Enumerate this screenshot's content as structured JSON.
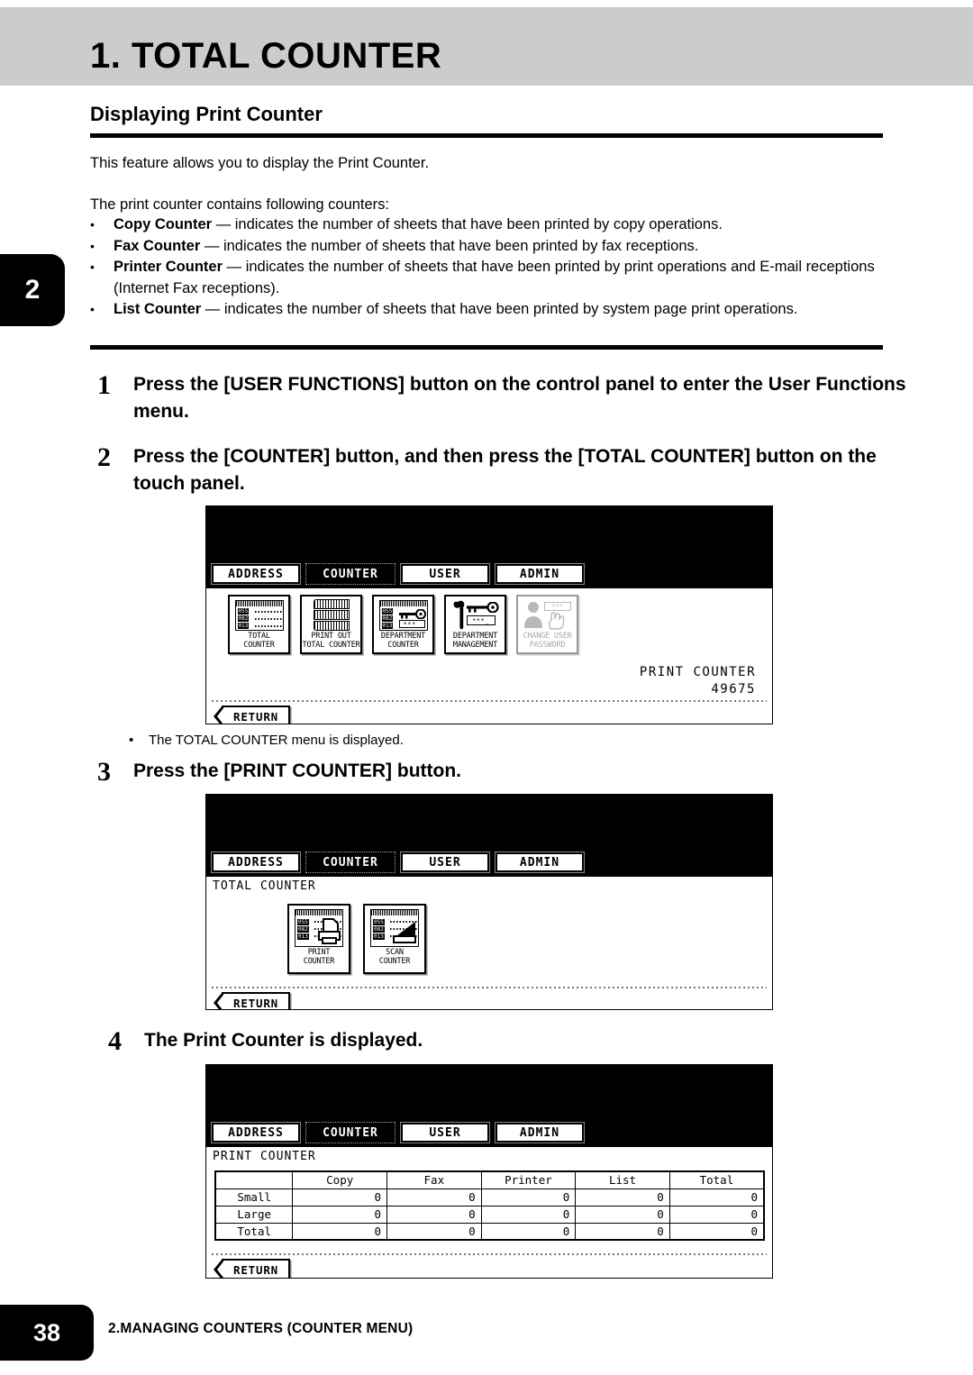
{
  "header": {
    "chapter_title": "1. TOTAL COUNTER",
    "chapter_tab_number": "2"
  },
  "section": {
    "heading": "Displaying Print Counter",
    "intro": "This feature allows you to display the Print Counter.",
    "list_intro": "The print counter contains following counters:",
    "bullet_marker": "•",
    "bullets": [
      {
        "term": "Copy Counter",
        "dash": " — ",
        "text": "indicates the number of sheets that have been printed by copy operations."
      },
      {
        "term": "Fax Counter",
        "dash": " — ",
        "text": "indicates the number of sheets that have been printed by fax receptions."
      },
      {
        "term": "Printer Counter",
        "dash": " — ",
        "text": "indicates the number of sheets that have been printed by print operations and E-mail receptions (Internet Fax receptions)."
      },
      {
        "term": "List Counter",
        "dash": " — ",
        "text": "indicates the number of sheets that have been printed by system page print operations."
      }
    ]
  },
  "steps": [
    {
      "num": "1",
      "text": "Press the [USER FUNCTIONS] button on the control panel to enter the User Functions menu."
    },
    {
      "num": "2",
      "text": "Press the [COUNTER] button, and then press the [TOTAL COUNTER] button on the touch panel."
    },
    {
      "num": "3",
      "text": "Press the [PRINT COUNTER] button."
    },
    {
      "num": "4",
      "text": "The Print Counter is displayed."
    }
  ],
  "note": {
    "bullet": "•",
    "text": "The TOTAL COUNTER menu is displayed."
  },
  "panel1": {
    "tabs": [
      {
        "label": "ADDRESS",
        "active": false
      },
      {
        "label": "COUNTER",
        "active": true
      },
      {
        "label": "USER",
        "active": false
      },
      {
        "label": "ADMIN",
        "active": false
      }
    ],
    "icons": [
      {
        "name": "total-counter",
        "line1": "TOTAL",
        "line2": "COUNTER",
        "disabled": false
      },
      {
        "name": "print-out-total-counter",
        "line1": "PRINT OUT",
        "line2": "TOTAL COUNTER",
        "disabled": false
      },
      {
        "name": "department-counter",
        "line1": "DEPARTMENT",
        "line2": "COUNTER",
        "disabled": false
      },
      {
        "name": "department-management",
        "line1": "DEPARTMENT",
        "line2": "MANAGEMENT",
        "disabled": false
      },
      {
        "name": "change-user-password",
        "line1": "CHANGE USER",
        "line2": "PASSWORD",
        "disabled": true
      }
    ],
    "readout_label": "PRINT COUNTER",
    "readout_value": "49675",
    "return_label": "RETURN",
    "digits": [
      "055",
      "082",
      "013"
    ],
    "password_mask": "***_"
  },
  "panel2": {
    "tabs": [
      {
        "label": "ADDRESS",
        "active": false
      },
      {
        "label": "COUNTER",
        "active": true
      },
      {
        "label": "USER",
        "active": false
      },
      {
        "label": "ADMIN",
        "active": false
      }
    ],
    "caption": "TOTAL COUNTER",
    "icons": [
      {
        "name": "print-counter",
        "line1": "PRINT",
        "line2": "COUNTER"
      },
      {
        "name": "scan-counter",
        "line1": "SCAN",
        "line2": "COUNTER"
      }
    ],
    "return_label": "RETURN",
    "digits": [
      "055",
      "082",
      "013"
    ]
  },
  "panel3": {
    "tabs": [
      {
        "label": "ADDRESS",
        "active": false
      },
      {
        "label": "COUNTER",
        "active": true
      },
      {
        "label": "USER",
        "active": false
      },
      {
        "label": "ADMIN",
        "active": false
      }
    ],
    "caption": "PRINT COUNTER",
    "table": {
      "columns": [
        "",
        "Copy",
        "Fax",
        "Printer",
        "List",
        "Total"
      ],
      "rows": [
        {
          "label": "Small",
          "values": [
            "0",
            "0",
            "0",
            "0",
            "0"
          ]
        },
        {
          "label": "Large",
          "values": [
            "0",
            "0",
            "0",
            "0",
            "0"
          ]
        },
        {
          "label": "Total",
          "values": [
            "0",
            "0",
            "0",
            "0",
            "0"
          ]
        }
      ]
    },
    "return_label": "RETURN"
  },
  "footer": {
    "page_number": "38",
    "running_head": "2.MANAGING COUNTERS (COUNTER MENU)"
  }
}
